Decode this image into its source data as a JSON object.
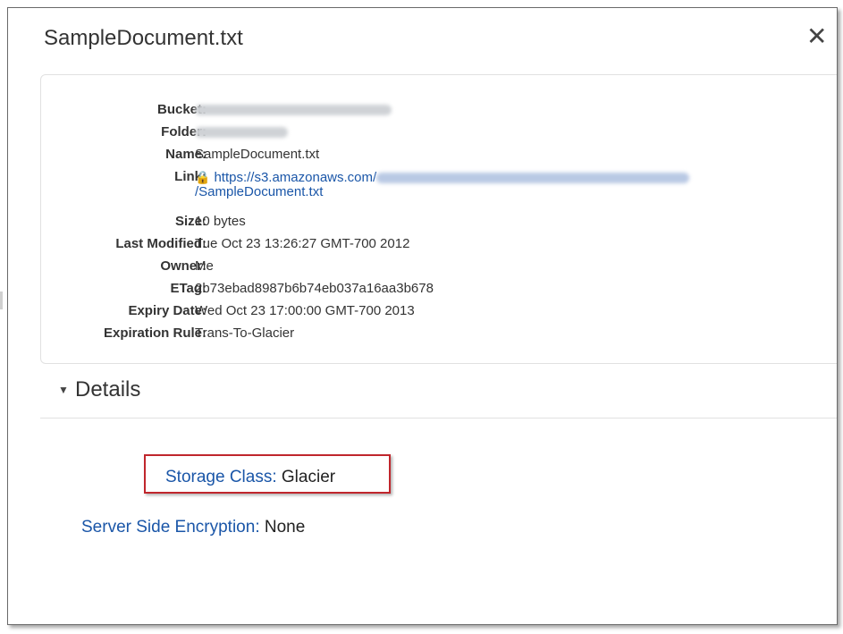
{
  "dialog": {
    "title": "SampleDocument.txt",
    "close_label": "✕"
  },
  "properties": [
    {
      "label": "Bucket:",
      "value": "",
      "redacted": true
    },
    {
      "label": "Folder:",
      "value": "",
      "redacted": true
    },
    {
      "label": "Name:",
      "value": "SampleDocument.txt"
    },
    {
      "label": "Link:",
      "link_prefix": "https://s3.amazonaws.com/",
      "link_suffix": "/SampleDocument.txt"
    },
    {
      "label": "Size:",
      "value": "10 bytes"
    },
    {
      "label": "Last Modified:",
      "value": "Tue Oct 23 13:26:27 GMT-700 2012"
    },
    {
      "label": "Owner:",
      "value": "Me"
    },
    {
      "label": "ETag:",
      "value": "2b73ebad8987b6b74eb037a16aa3b678"
    },
    {
      "label": "Expiry Date:",
      "value": "Wed Oct 23 17:00:00 GMT-700 2013"
    },
    {
      "label": "Expiration Rule:",
      "value": "Trans-To-Glacier"
    }
  ],
  "details": {
    "header": "Details",
    "storage_class_label": "Storage Class:",
    "storage_class_value": "Glacier",
    "sse_label": "Server Side Encryption:",
    "sse_value": "None"
  },
  "icons": {
    "lock": "lock-icon",
    "caret": "caret-down-icon",
    "close": "close-icon"
  },
  "colors": {
    "link": "#1a56a8",
    "highlight": "#c0262c"
  }
}
